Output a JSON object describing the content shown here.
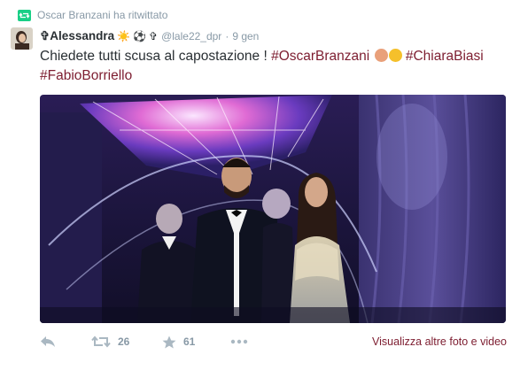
{
  "retweet_context": {
    "text": "Oscar Branzani ha ritwittato",
    "icon": "retweet-icon"
  },
  "author": {
    "fullname": "✞Alessandra",
    "emojis": [
      "☀️",
      "⚽",
      "✞"
    ],
    "username": "@lale22_dpr",
    "separator": "·",
    "timestamp": "9 gen"
  },
  "tweet": {
    "text_prefix": "Chiedete tutti scusa al capostazione ! ",
    "hashtags": [
      "#OscarBranzani",
      "#ChiaraBiasi",
      "#FabioBorriello"
    ],
    "emojis": [
      "clapping-hands",
      "tears-of-joy"
    ]
  },
  "media": {
    "description_icon": "photo"
  },
  "actions": {
    "reply_icon": "reply-icon",
    "retweet_icon": "retweet-icon",
    "retweet_count": "26",
    "favorite_icon": "star-icon",
    "favorite_count": "61",
    "more_icon": "more-icon",
    "view_more_label": "Visualizza altre foto e video"
  },
  "colors": {
    "link": "#7d1d30",
    "muted": "#8899a6",
    "text": "#292f33"
  }
}
